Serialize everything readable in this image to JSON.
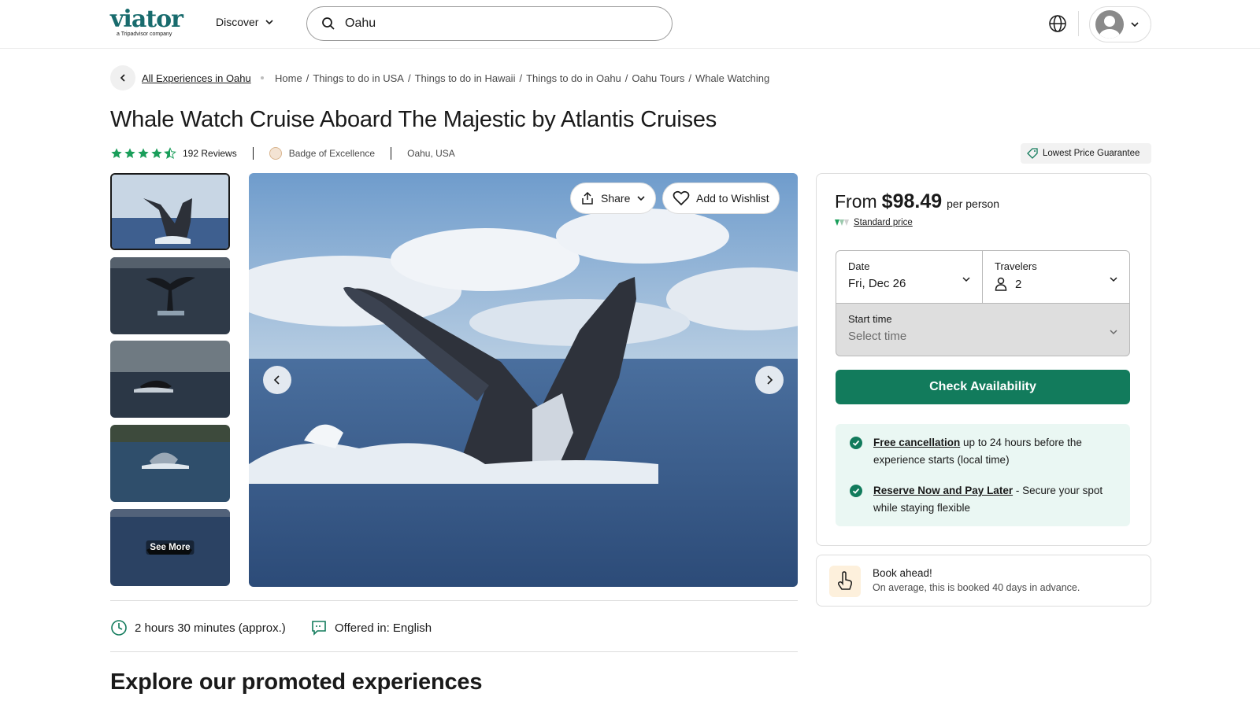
{
  "header": {
    "logo_text": "viator",
    "logo_sub": "a Tripadvisor company",
    "discover_label": "Discover",
    "search_value": "Oahu"
  },
  "breadcrumb": {
    "back_label": "All Experiences in Oahu",
    "items": [
      "Home",
      "Things to do in USA",
      "Things to do in Hawaii",
      "Things to do in Oahu",
      "Oahu Tours",
      "Whale Watching"
    ],
    "separator": "/"
  },
  "product": {
    "title": "Whale Watch Cruise Aboard The Majestic by Atlantis Cruises",
    "rating": 4.5,
    "reviews_label": "192 Reviews",
    "badge_label": "Badge of Excellence",
    "location": "Oahu, USA",
    "lowest_price_label": "Lowest Price Guarantee"
  },
  "gallery": {
    "see_more_label": "See More",
    "share_label": "Share",
    "wishlist_label": "Add to Wishlist"
  },
  "info": {
    "duration": "2 hours 30 minutes (approx.)",
    "languages": "Offered in: English"
  },
  "explore_heading": "Explore our promoted experiences",
  "booking": {
    "from_label": "From",
    "price": "$98.49",
    "per_label": "per person",
    "standard_price_label": "Standard price",
    "date_label": "Date",
    "date_value": "Fri, Dec 26",
    "travelers_label": "Travelers",
    "travelers_value": "2",
    "start_time_label": "Start time",
    "start_time_placeholder": "Select time",
    "check_button": "Check Availability",
    "perk1_link": "Free cancellation",
    "perk1_text": " up to 24 hours before the experience starts (local time)",
    "perk2_link": "Reserve Now and Pay Later",
    "perk2_text": " - Secure your spot while staying flexible",
    "accent_color": "#127b5c"
  },
  "book_ahead": {
    "title": "Book ahead!",
    "subtitle": "On average, this is booked 40 days in advance."
  }
}
